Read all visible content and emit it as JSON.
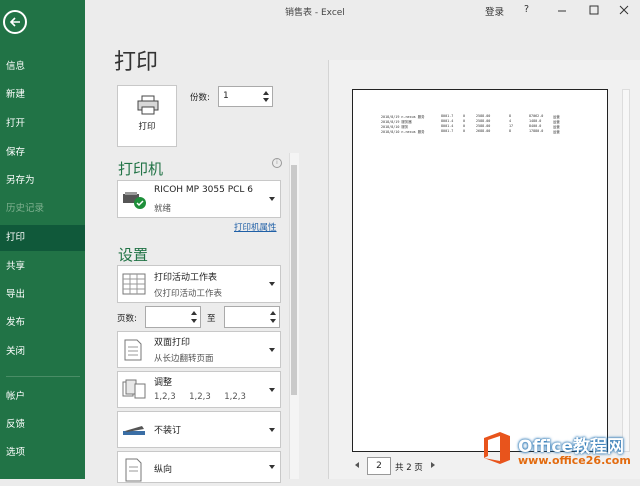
{
  "window": {
    "title": "销售表  -  Excel",
    "login": "登录",
    "help": "?"
  },
  "nav": {
    "items": [
      {
        "label": "信息"
      },
      {
        "label": "新建"
      },
      {
        "label": "打开"
      },
      {
        "label": "保存"
      },
      {
        "label": "另存为"
      },
      {
        "label": "历史记录"
      },
      {
        "label": "打印"
      },
      {
        "label": "共享"
      },
      {
        "label": "导出"
      },
      {
        "label": "发布"
      },
      {
        "label": "关闭"
      },
      {
        "label": "帐户"
      },
      {
        "label": "反馈"
      },
      {
        "label": "选项"
      }
    ],
    "active": "打印",
    "disabled": "历史记录"
  },
  "print": {
    "title": "打印",
    "print_button": "打印",
    "copies_label": "份数:",
    "copies_value": "1",
    "printer_heading": "打印机",
    "printer_name": "RICOH MP 3055 PCL 6",
    "printer_status": "就绪",
    "printer_props_link": "打印机属性",
    "settings_heading": "设置",
    "settings": [
      {
        "title": "打印活动工作表",
        "subtitle": "仅打印活动工作表",
        "icon": "sheet-grid-icon"
      },
      {
        "title": "双面打印",
        "subtitle": "从长边翻转页面",
        "icon": "duplex-page-icon"
      },
      {
        "title": "调整",
        "subtitle": "1,2,3     1,2,3     1,2,3",
        "icon": "collate-icon"
      },
      {
        "title": "不装订",
        "subtitle": "",
        "icon": "stapler-icon"
      },
      {
        "title": "纵向",
        "subtitle": "",
        "icon": "portrait-page-icon"
      }
    ],
    "pages_label": "页数:",
    "to_label": "至"
  },
  "preview": {
    "rows": [
      [
        "2018/8/19 n-nexus 服务",
        "8001.7",
        "0",
        "2588.00",
        "8",
        "87062.0",
        "运营"
      ],
      [
        "2018/8/19 服务器",
        "8001.4",
        "0",
        "2588.00",
        "4",
        "1480.0",
        "运营"
      ],
      [
        "2018/8/10 服务",
        "8001.4",
        "0",
        "2588.00",
        "17",
        "8400.0",
        "运营"
      ],
      [
        "2018/8/10 n-nexus 服务",
        "8001.7",
        "0",
        "2688.00",
        "8",
        "17880.0",
        "运营"
      ]
    ],
    "page_current": "2",
    "page_total": "共 2 页"
  },
  "watermark": {
    "line1": "Office教程网",
    "line2": "www.office26.com"
  },
  "colors": {
    "excel_green": "#217346",
    "active_nav": "#10593a",
    "link_blue": "#1f5fa6"
  }
}
